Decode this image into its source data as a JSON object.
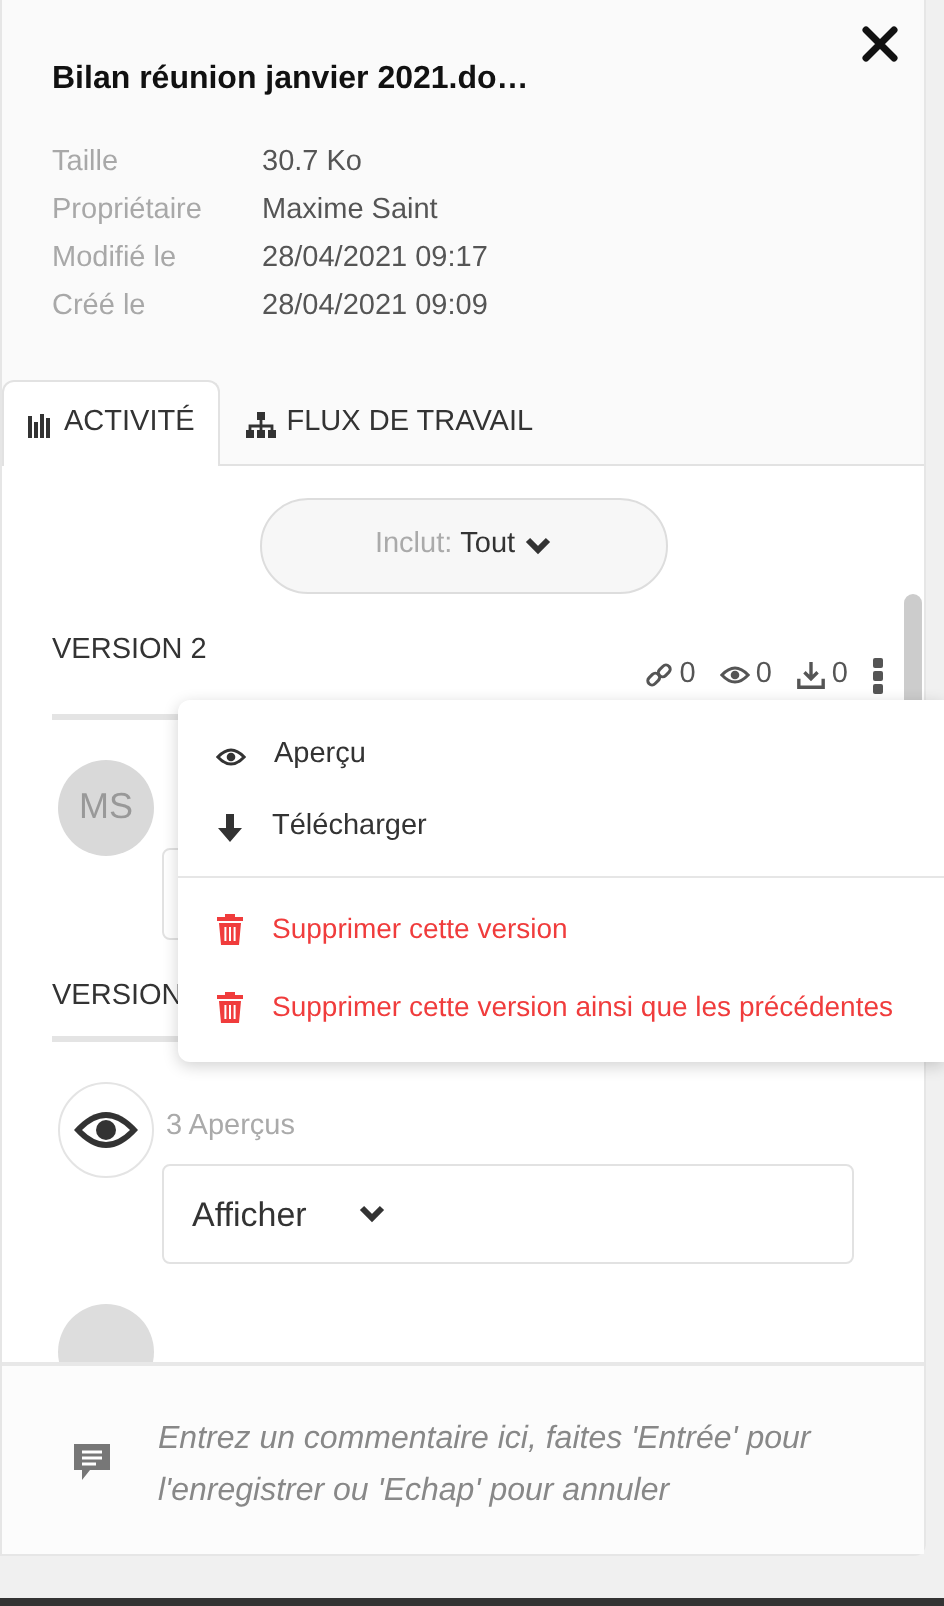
{
  "title": "Bilan réunion janvier 2021.do…",
  "details": [
    {
      "label": "Taille",
      "value": "30.7 Ko"
    },
    {
      "label": "Propriétaire",
      "value": "Maxime Saint"
    },
    {
      "label": "Modifié le",
      "value": "28/04/2021 09:17"
    },
    {
      "label": "Créé le",
      "value": "28/04/2021 09:09"
    }
  ],
  "tabs": [
    {
      "kind": "activity",
      "label": "ACTIVITÉ",
      "selected": true
    },
    {
      "kind": "workflow",
      "label": "FLUX DE TRAVAIL",
      "selected": false
    }
  ],
  "filter": {
    "label": "Inclut:",
    "value": "Tout"
  },
  "feed": [
    {
      "kind": "version",
      "title": "VERSION 2",
      "stats": [
        {
          "kind": "link",
          "count": "0"
        },
        {
          "kind": "view",
          "count": "0"
        },
        {
          "kind": "download",
          "count": "0"
        }
      ]
    },
    {
      "kind": "comment",
      "avatar": {
        "kind": "initials",
        "text": "MS"
      }
    },
    {
      "kind": "version",
      "title": "VERSION"
    },
    {
      "kind": "entry",
      "avatar": {
        "kind": "eye"
      },
      "text": "3 Aperçus",
      "select": "Afficher"
    },
    {
      "kind": "entry",
      "avatar": {
        "kind": "blank"
      }
    }
  ],
  "menu": [
    {
      "kind": "preview",
      "label": "Aperçu"
    },
    {
      "kind": "download",
      "label": "Télécharger"
    },
    {
      "kind": "delete",
      "label": "Supprimer cette version"
    },
    {
      "kind": "delete",
      "label": "Supprimer cette version ainsi que les précédentes"
    }
  ],
  "comment": {
    "placeholder": "Entrez un commentaire ici, faites 'Entrée' pour l'enregistrer ou 'Echap' pour annuler"
  }
}
